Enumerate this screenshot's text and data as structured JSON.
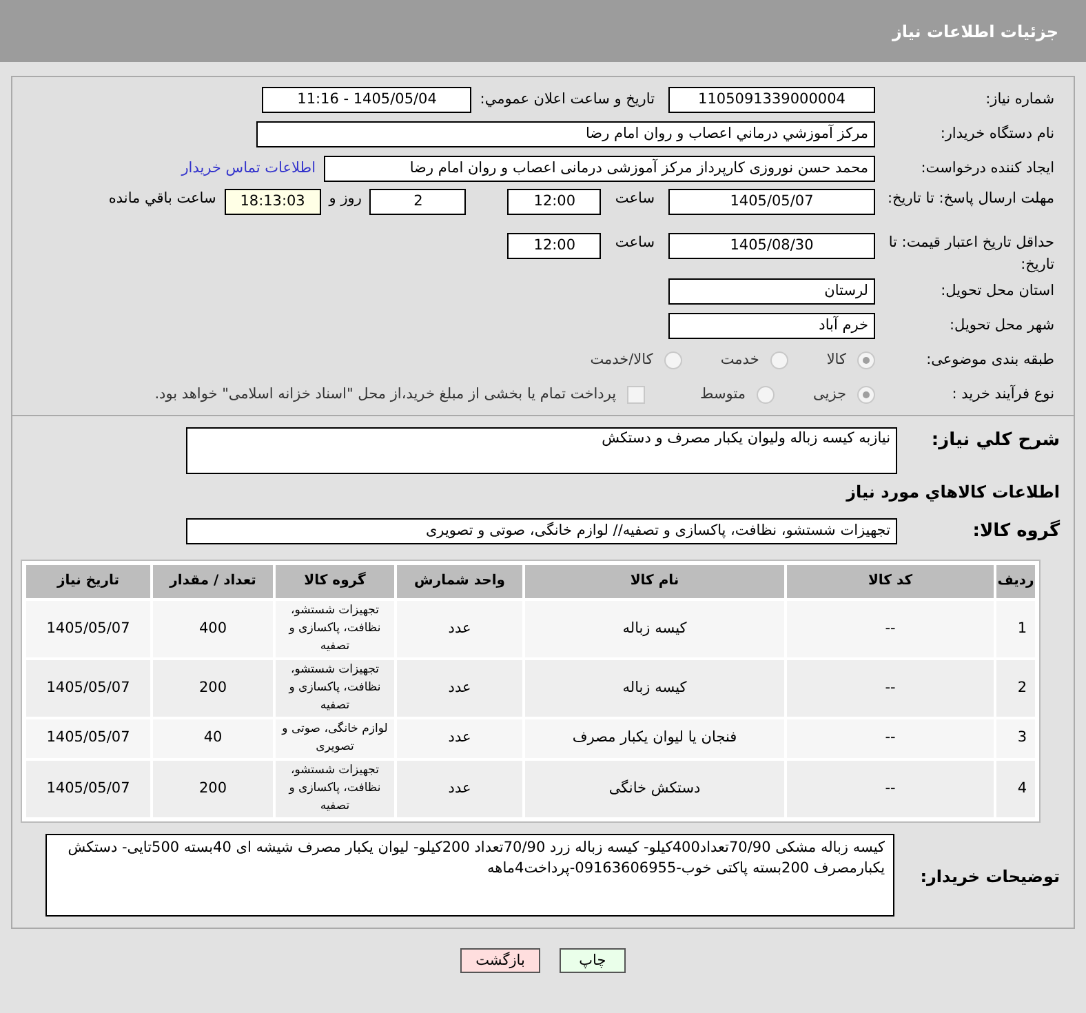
{
  "header": {
    "title": "جزئیات اطلاعات نیاز"
  },
  "need_number": {
    "label": "شماره نیاز:",
    "value": "1105091339000004"
  },
  "announcement": {
    "label": "تاریخ و ساعت اعلان عمومي:",
    "value": "1405/05/04 - 11:16"
  },
  "buyer_org": {
    "label": "نام دستگاه خریدار:",
    "value": "مرکز آموزشي درماني اعصاب و روان امام رضا"
  },
  "requester": {
    "label": "ایجاد کننده درخواست:",
    "value": "محمد حسن نوروزی کارپرداز مرکز آموزشی درمانی اعصاب و روان امام رضا",
    "link": "اطلاعات تماس خریدار"
  },
  "deadline": {
    "label": "مهلت ارسال پاسخ: تا تاریخ:",
    "date": "1405/05/07",
    "time_label": "ساعت",
    "time": "12:00",
    "days": "2",
    "days_label": "روز و",
    "remaining": "18:13:03",
    "remaining_label": "ساعت باقي مانده"
  },
  "validity": {
    "label": "حداقل تاریخ اعتبار قیمت: تا تاریخ:",
    "date": "1405/08/30",
    "time_label": "ساعت",
    "time": "12:00"
  },
  "province": {
    "label": "استان محل تحویل:",
    "value": "لرستان"
  },
  "city": {
    "label": "شهر محل تحویل:",
    "value": "خرم آباد"
  },
  "category": {
    "label": "طبقه بندی موضوعی:",
    "options": [
      {
        "label": "کالا",
        "selected": true
      },
      {
        "label": "خدمت",
        "selected": false
      },
      {
        "label": "کالا/خدمت",
        "selected": false
      }
    ]
  },
  "purchase_type": {
    "label": "نوع فرآیند خرید :",
    "options": [
      {
        "label": "جزیی",
        "selected": true
      },
      {
        "label": "متوسط",
        "selected": false
      }
    ],
    "payment": {
      "label": "پرداخت تمام یا بخشی از مبلغ خرید،از محل \"اسناد خزانه اسلامی\" خواهد بود.",
      "checked": false
    }
  },
  "description": {
    "label": "شرح کلي نیاز:",
    "value": "نیازبه کیسه زباله ولیوان یکبار مصرف و دستکش"
  },
  "goods_title": "اطلاعات کالاهاي مورد نیاز",
  "goods_group": {
    "label": "گروه کالا:",
    "value": "تجهیزات شستشو، نظافت، پاکسازی و تصفیه// لوازم خانگی، صوتی و تصویری"
  },
  "table": {
    "columns": [
      "ردیف",
      "کد کالا",
      "نام کالا",
      "واحد شمارش",
      "گروه کالا",
      "تعداد / مقدار",
      "تاریخ نیاز"
    ],
    "rows": [
      [
        "1",
        "--",
        "کیسه زباله",
        "عدد",
        "تجهیزات شستشو، نظافت، پاکسازی و تصفیه",
        "400",
        "1405/05/07"
      ],
      [
        "2",
        "--",
        "کیسه زباله",
        "عدد",
        "تجهیزات شستشو، نظافت، پاکسازی و تصفیه",
        "200",
        "1405/05/07"
      ],
      [
        "3",
        "--",
        "فنجان یا لیوان یکبار مصرف",
        "عدد",
        "لوازم خانگی، صوتی و تصویری",
        "40",
        "1405/05/07"
      ],
      [
        "4",
        "--",
        "دستکش خانگی",
        "عدد",
        "تجهیزات شستشو، نظافت، پاکسازی و تصفیه",
        "200",
        "1405/05/07"
      ]
    ]
  },
  "buyer_notes": {
    "label": "توضیحات خریدار:",
    "value": "کیسه زباله مشکی 70/90تعداد400کیلو- کیسه زباله زرد 70/90تعداد 200کیلو- لیوان یکبار مصرف شیشه ای 40بسته 500تایی- دستکش یکبارمصرف  200بسته پاکتی خوب-09163606955-پرداخت4ماهه"
  },
  "buttons": [
    {
      "label": "چاپ",
      "kind": "print"
    },
    {
      "label": "بازگشت",
      "kind": "back"
    }
  ]
}
